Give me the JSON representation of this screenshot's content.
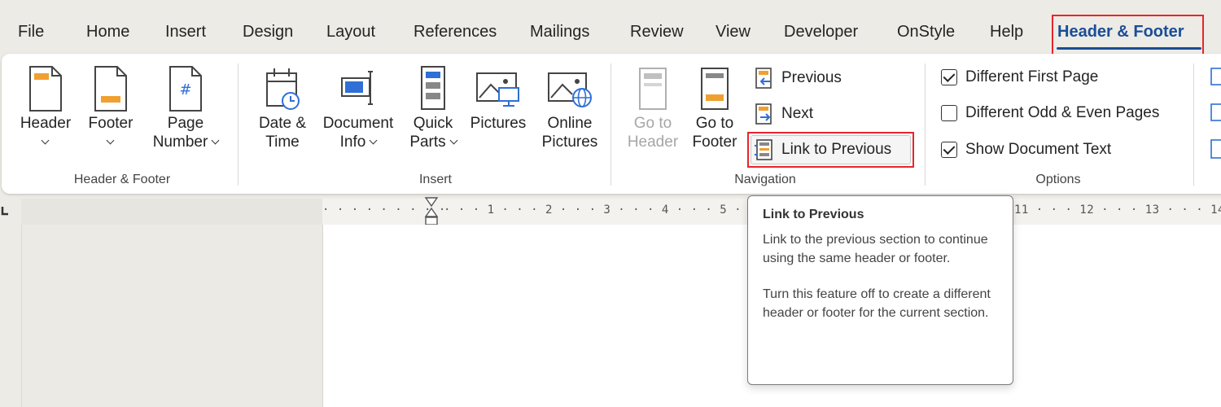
{
  "tabs": [
    {
      "label": "File"
    },
    {
      "label": "Home"
    },
    {
      "label": "Insert"
    },
    {
      "label": "Design"
    },
    {
      "label": "Layout"
    },
    {
      "label": "References"
    },
    {
      "label": "Mailings"
    },
    {
      "label": "Review"
    },
    {
      "label": "View"
    },
    {
      "label": "Developer"
    },
    {
      "label": "OnStyle"
    },
    {
      "label": "Help"
    },
    {
      "label": "Header & Footer",
      "active": true
    }
  ],
  "groups": {
    "header_footer": {
      "label": "Header & Footer",
      "buttons": {
        "header": {
          "line1": "Header",
          "icon": "header-page-icon"
        },
        "footer": {
          "line1": "Footer",
          "icon": "footer-page-icon"
        },
        "page_number": {
          "line1": "Page",
          "line2": "Number",
          "icon": "page-number-icon"
        }
      }
    },
    "insert": {
      "label": "Insert",
      "buttons": {
        "date_time": {
          "line1": "Date &",
          "line2": "Time",
          "icon": "calendar-clock-icon"
        },
        "document_info": {
          "line1": "Document",
          "line2": "Info",
          "icon": "document-info-icon"
        },
        "quick_parts": {
          "line1": "Quick",
          "line2": "Parts",
          "icon": "quick-parts-icon"
        },
        "pictures": {
          "line1": "Pictures",
          "icon": "pictures-icon"
        },
        "online_pictures": {
          "line1": "Online",
          "line2": "Pictures",
          "icon": "online-pictures-icon"
        }
      }
    },
    "navigation": {
      "label": "Navigation",
      "buttons": {
        "go_to_header": {
          "line1": "Go to",
          "line2": "Header",
          "disabled": true
        },
        "go_to_footer": {
          "line1": "Go to",
          "line2": "Footer"
        },
        "previous": {
          "label": "Previous",
          "icon": "previous-section-icon"
        },
        "next": {
          "label": "Next",
          "icon": "next-section-icon"
        },
        "link_to_previous": {
          "label": "Link to Previous",
          "icon": "link-to-previous-icon"
        }
      }
    },
    "options": {
      "label": "Options",
      "checks": {
        "different_first_page": {
          "label": "Different First Page",
          "checked": true
        },
        "different_odd_even": {
          "label": "Different Odd & Even Pages",
          "checked": false
        },
        "show_document_text": {
          "label": "Show Document Text",
          "checked": true
        }
      }
    }
  },
  "ruler": {
    "left_text": "· · · · · · · · ·",
    "mid_text": "· · · 1 · · · 2 · · · 3 · · · 4 · · · 5 · · ·",
    "right_text": "11 · · · 12 · · · 13 · · · 14 · · ·"
  },
  "tooltip": {
    "title": "Link to Previous",
    "para1": "Link to the previous section to continue using the same header or footer.",
    "para2": "Turn this feature off to create a different header or footer for the current section."
  },
  "colors": {
    "accent": "#1a4d96",
    "highlight": "#e8242b",
    "icon_orange": "#f0a030",
    "icon_blue": "#2f6fd6"
  }
}
